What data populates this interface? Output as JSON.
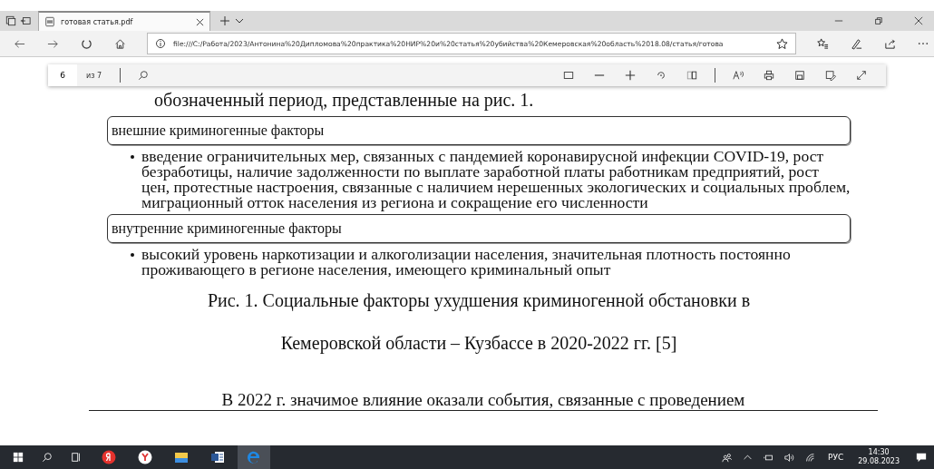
{
  "tabs": [
    {
      "title": "готовая статья.pdf",
      "selected": true
    }
  ],
  "address": {
    "url": "file:///C:/Работа/2023/Антонина%20Дипломова%20практика%20НИР%20и%20статья%20убийства%20Кемеровская%20область%2018.08/статья/готова"
  },
  "pdf_toolbar": {
    "page": "6",
    "page_count": "из 7"
  },
  "document": {
    "intro": "обозначенный период, представленные на рис. 1.",
    "groups": [
      {
        "heading": "внешние криминогенные факторы",
        "bullet": "введение ограничительных мер, связанных с пандемией коронавирусной инфекции COVID-19, рост безработицы, наличие задолженности по выплате заработной платы работникам предприятий, рост цен, протестные настроения, связанные с наличием нерешенных экологических и социальных проблем, миграционный отток населения из региона и сокращение его численности"
      },
      {
        "heading": "внутренние криминогенные факторы",
        "bullet": "высокий уровень наркотизации и алкоголизации населения, значительная плотность постоянно проживающего в регионе населения, имеющего криминальный опыт"
      }
    ],
    "caption": [
      "Рис. 1. Социальные факторы ухудшения криминогенной обстановки в",
      "Кемеровской области – Кузбассе в 2020-2022 гг. [5]"
    ],
    "next_paragraph": "В 2022 г. значимое влияние оказали события, связанные с проведением"
  },
  "taskbar": {
    "apps": [
      {
        "kind": "yandex",
        "selected": false
      },
      {
        "kind": "browser",
        "selected": false
      },
      {
        "kind": "explorer",
        "selected": false
      },
      {
        "kind": "word",
        "selected": false
      },
      {
        "kind": "edge",
        "selected": true
      }
    ],
    "language": "РУС",
    "time": "14:30",
    "date": "29.08.2023"
  }
}
